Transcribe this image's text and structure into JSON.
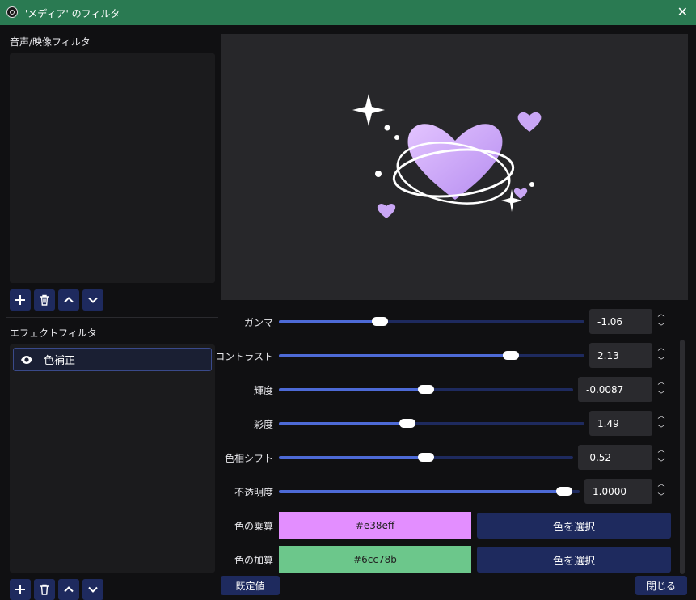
{
  "window": {
    "title": "'メディア' のフィルタ",
    "close_icon": "✕"
  },
  "audio_video_filters": {
    "label": "音声/映像フィルタ"
  },
  "effect_filters": {
    "label": "エフェクトフィルタ",
    "items": [
      {
        "name": "色補正",
        "visible": true
      }
    ]
  },
  "toolbar_icons": [
    "plus-icon",
    "trash-icon",
    "chevron-up-icon",
    "chevron-down-icon"
  ],
  "properties": {
    "gamma": {
      "label": "ガンマ",
      "value": "-1.06",
      "slider_fraction": 0.33
    },
    "contrast": {
      "label": "コントラスト",
      "value": "2.13",
      "slider_fraction": 0.76
    },
    "brightness": {
      "label": "輝度",
      "value": "-0.0087",
      "slider_fraction": 0.5
    },
    "saturation": {
      "label": "彩度",
      "value": "1.49",
      "slider_fraction": 0.42
    },
    "hue_shift": {
      "label": "色相シフト",
      "value": "-0.52",
      "slider_fraction": 0.5
    },
    "opacity": {
      "label": "不透明度",
      "value": "1.0000",
      "slider_fraction": 0.95
    },
    "color_multiply": {
      "label": "色の乗算",
      "hex": "#e38eff",
      "button": "色を選択"
    },
    "color_add": {
      "label": "色の加算",
      "hex": "#6cc78b",
      "button": "色を選択"
    }
  },
  "buttons": {
    "defaults": "既定値",
    "close": "閉じる"
  },
  "colors": {
    "titlebar": "#2a7a52",
    "accent": "#1e2a5e",
    "slider_fill": "#4d6ad6"
  }
}
